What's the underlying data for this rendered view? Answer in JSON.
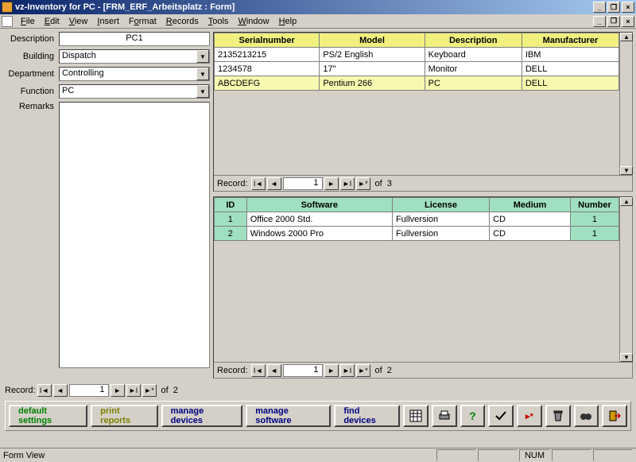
{
  "title": "vz-Inventory for PC - [FRM_ERF_Arbeitsplatz : Form]",
  "menu": {
    "file": "File",
    "edit": "Edit",
    "view": "View",
    "insert": "Insert",
    "format": "Format",
    "records": "Records",
    "tools": "Tools",
    "window": "Window",
    "help": "Help"
  },
  "labels": {
    "description": "Description",
    "building": "Building",
    "department": "Department",
    "function": "Function",
    "remarks": "Remarks",
    "record": "Record:",
    "of": "of"
  },
  "fields": {
    "description": "PC1",
    "building": "Dispatch",
    "department": "Controlling",
    "function": "PC",
    "remarks": ""
  },
  "hardware": {
    "headers": {
      "serial": "Serialnumber",
      "model": "Model",
      "description": "Description",
      "manufacturer": "Manufacturer"
    },
    "rows": [
      {
        "serial": "2135213215",
        "model": "PS/2 English",
        "description": "Keyboard",
        "manufacturer": "IBM"
      },
      {
        "serial": "1234578",
        "model": "17\"",
        "description": "Monitor",
        "manufacturer": "DELL"
      },
      {
        "serial": "ABCDEFG",
        "model": "Pentium 266",
        "description": "PC",
        "manufacturer": "DELL"
      }
    ],
    "nav": {
      "current": "1",
      "total": "3"
    }
  },
  "software": {
    "headers": {
      "id": "ID",
      "software": "Software",
      "license": "License",
      "medium": "Medium",
      "number": "Number"
    },
    "rows": [
      {
        "id": "1",
        "software": "Office 2000 Std.",
        "license": "Fullversion",
        "medium": "CD",
        "number": "1"
      },
      {
        "id": "2",
        "software": "Windows 2000 Pro",
        "license": "Fullversion",
        "medium": "CD",
        "number": "1"
      }
    ],
    "nav": {
      "current": "1",
      "total": "2"
    }
  },
  "main_nav": {
    "current": "1",
    "total": "2"
  },
  "toolbar": {
    "default": "default settings",
    "print": "print reports",
    "devices": "manage devices",
    "software": "manage software",
    "find": "find devices"
  },
  "status": {
    "text": "Form View",
    "num": "NUM"
  }
}
